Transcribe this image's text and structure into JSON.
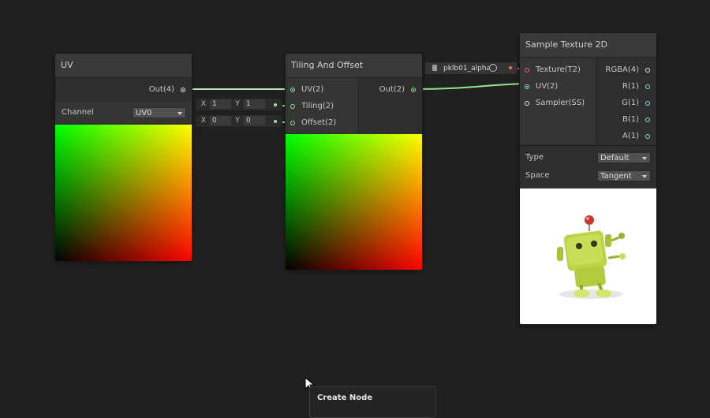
{
  "nodes": {
    "uv": {
      "title": "UV",
      "output_label": "Out(4)",
      "channel_label": "Channel",
      "channel_value": "UV0"
    },
    "tiling": {
      "title": "Tiling And Offset",
      "inputs": [
        "UV(2)",
        "Tiling(2)",
        "Offset(2)"
      ],
      "output_label": "Out(2)",
      "tiling_x": "1",
      "tiling_y": "1",
      "offset_x": "0",
      "offset_y": "0",
      "x_label": "X",
      "y_label": "Y"
    },
    "sample": {
      "title": "Sample Texture 2D",
      "inputs": [
        "Texture(T2)",
        "UV(2)",
        "Sampler(SS)"
      ],
      "outputs": [
        "RGBA(4)",
        "R(1)",
        "G(1)",
        "B(1)",
        "A(1)"
      ],
      "type_label": "Type",
      "type_value": "Default",
      "space_label": "Space",
      "space_value": "Tangent"
    },
    "texture_property": {
      "label": "pklb01_alpha"
    }
  },
  "menu": {
    "create_node_label": "Create Node"
  },
  "colors": {
    "background": "#202020",
    "wire_green": "#8ee68e",
    "wire_red": "#ff6a5a"
  }
}
